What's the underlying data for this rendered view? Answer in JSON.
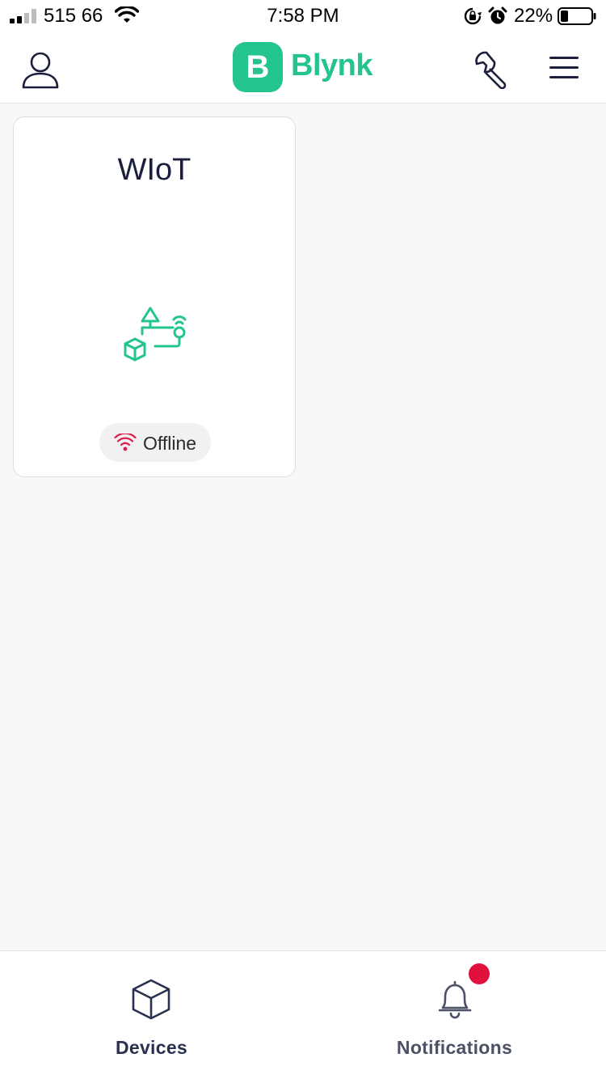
{
  "status_bar": {
    "carrier": "515 66",
    "time": "7:58 PM",
    "battery_percent": "22%",
    "icons": [
      "signal-icon",
      "wifi-icon",
      "orientation-lock-icon",
      "alarm-icon",
      "battery-icon"
    ]
  },
  "header": {
    "brand_badge": "B",
    "brand_name": "Blynk",
    "icons": [
      "profile-icon",
      "wrench-icon",
      "hamburger-menu-icon"
    ]
  },
  "devices": [
    {
      "name": "WIoT",
      "status": "Offline",
      "status_color": "#d81e49",
      "icon": "device-template-icon"
    }
  ],
  "tab_bar": {
    "tabs": [
      {
        "label": "Devices",
        "icon": "cube-icon",
        "active": true
      },
      {
        "label": "Notifications",
        "icon": "bell-icon",
        "active": false,
        "has_badge": true
      }
    ]
  },
  "colors": {
    "brand": "#23c48e",
    "badge": "#e0113f",
    "offline": "#d81e49",
    "text_dark": "#1b1f3b"
  }
}
